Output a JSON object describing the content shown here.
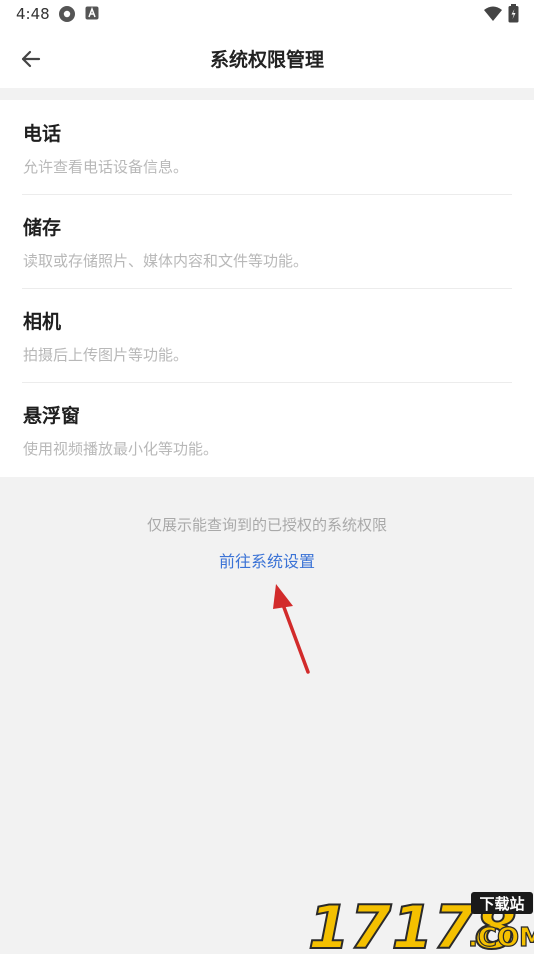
{
  "status_bar": {
    "time": "4:48",
    "icons": [
      "settings-icon",
      "a-badge-icon",
      "wifi-icon",
      "battery-icon"
    ]
  },
  "header": {
    "title": "系统权限管理",
    "back_icon": "arrow-left-icon"
  },
  "permissions": [
    {
      "title": "电话",
      "desc": "允许查看电话设备信息。"
    },
    {
      "title": "储存",
      "desc": "读取或存储照片、媒体内容和文件等功能。"
    },
    {
      "title": "相机",
      "desc": "拍摄后上传图片等功能。"
    },
    {
      "title": "悬浮窗",
      "desc": "使用视频播放最小化等功能。"
    }
  ],
  "footer": {
    "note": "仅展示能查询到的已授权的系统权限",
    "link": "前往系统设置"
  },
  "watermark": {
    "brand": "17178",
    "tag": "下载站",
    "domain": ".COM"
  },
  "colors": {
    "background": "#f2f2f2",
    "card": "#ffffff",
    "link": "#3b73d6",
    "annotation_arrow": "#d22b2b"
  }
}
